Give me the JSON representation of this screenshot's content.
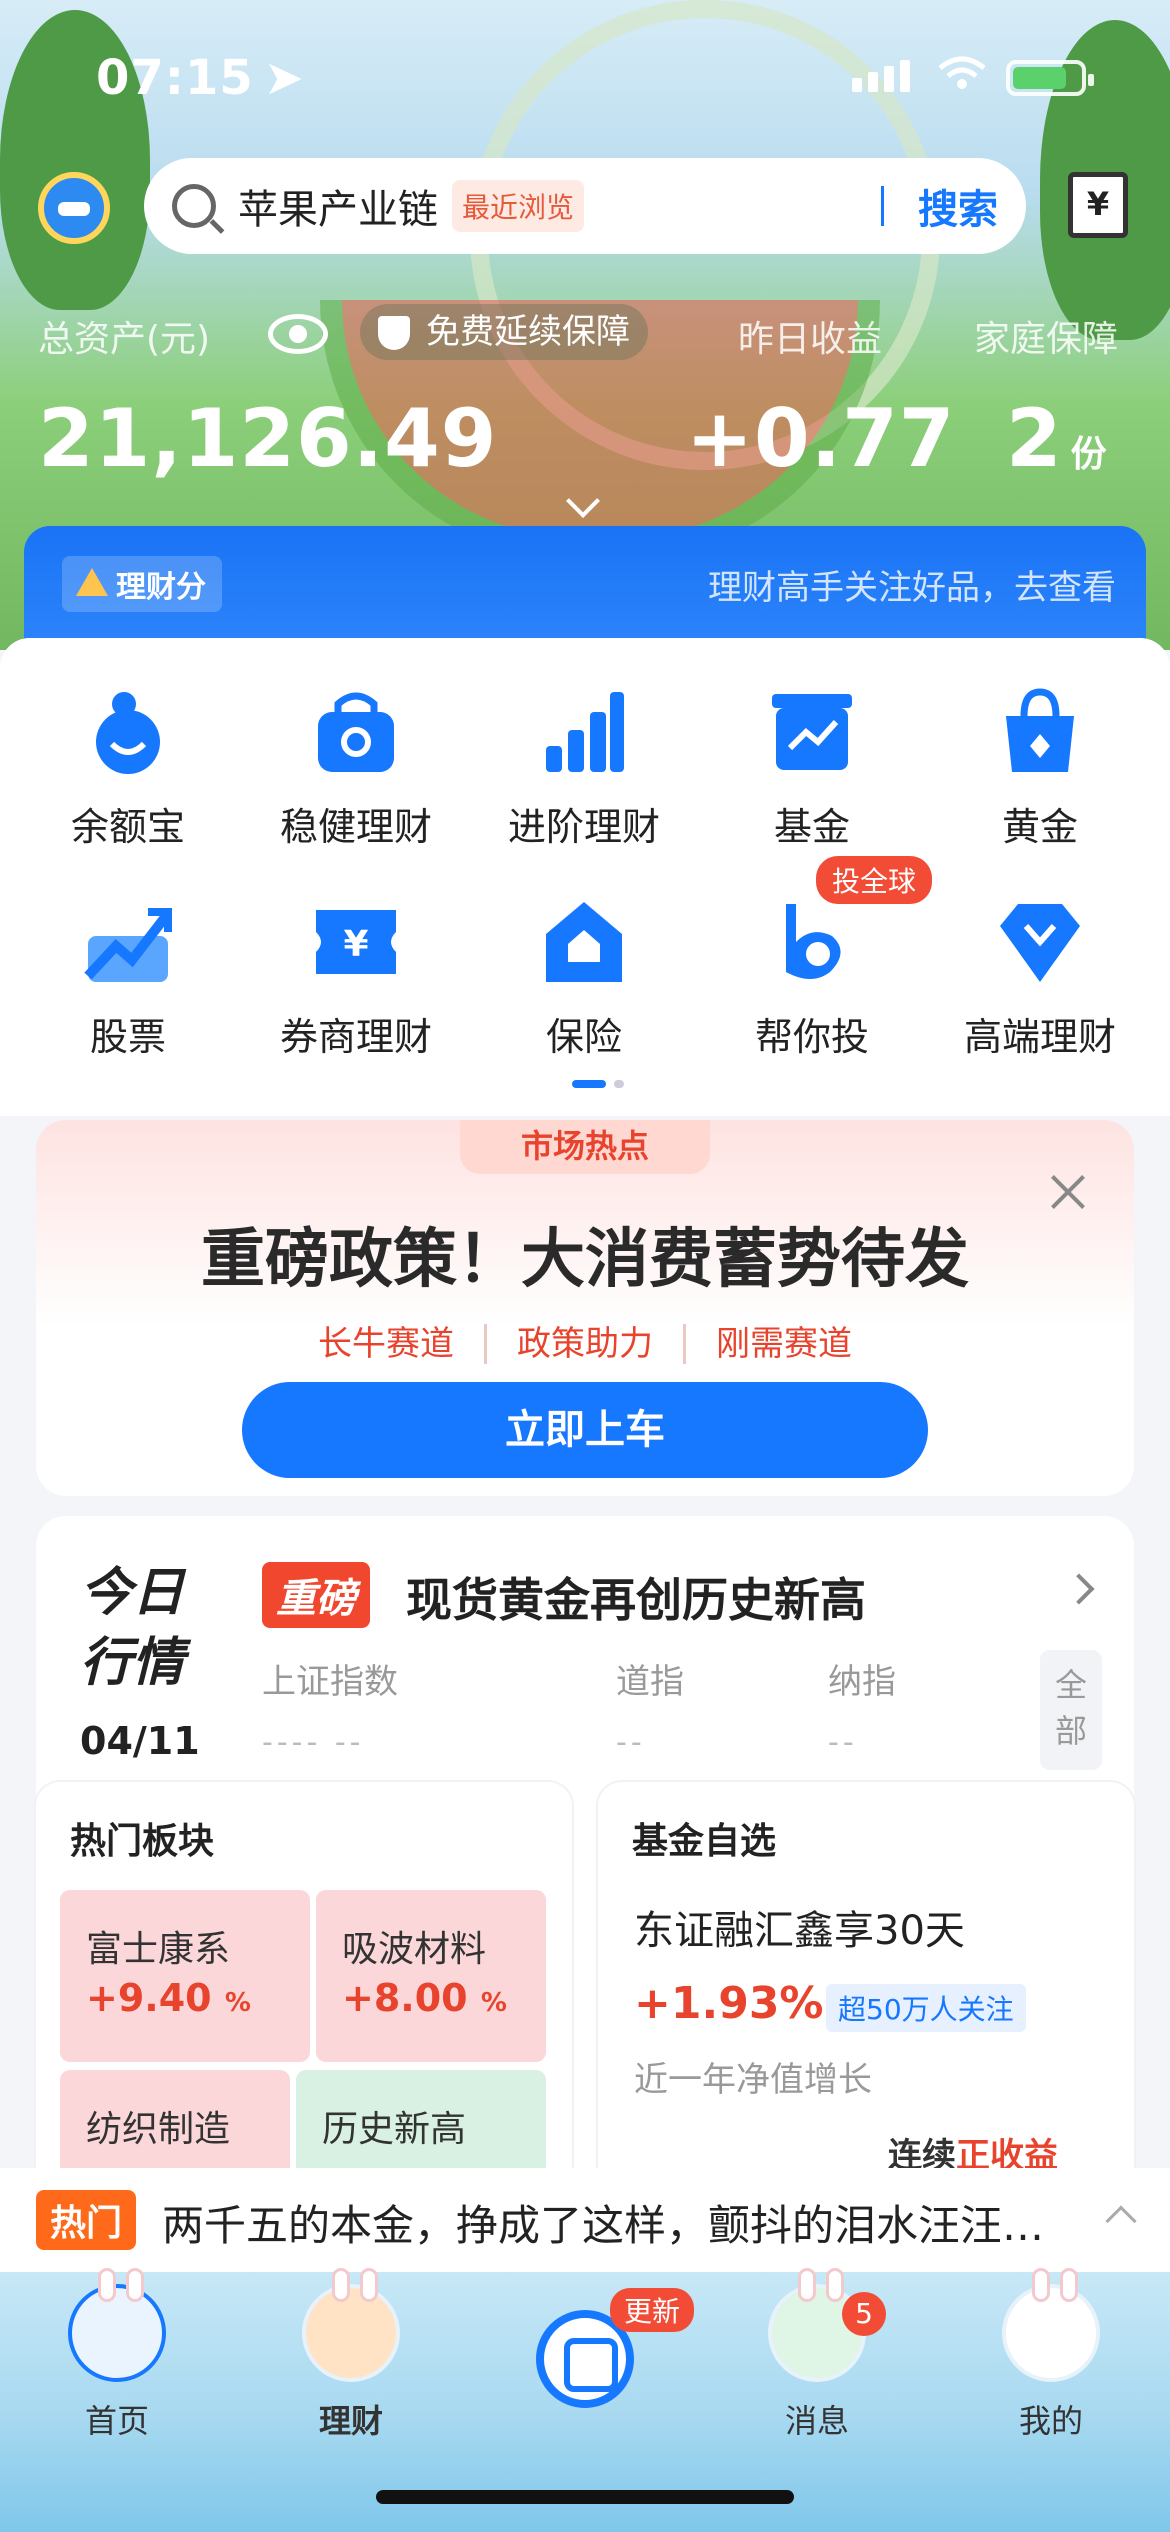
{
  "status": {
    "time": "07:15"
  },
  "search": {
    "keyword": "苹果产业链",
    "recent_chip": "最近浏览",
    "button": "搜索"
  },
  "assets": {
    "total_label": "总资产(元)",
    "total_value": "21,126.49",
    "protection_label": "免费延续保障",
    "yesterday_label": "昨日收益",
    "yesterday_value": "+0.77",
    "family_label": "家庭保障",
    "family_value": "2",
    "family_unit": "份"
  },
  "score": {
    "tag": "理财分",
    "text": "理财高手关注好品，去查看"
  },
  "grid": [
    {
      "label": "余额宝",
      "icon": "yuebao-icon"
    },
    {
      "label": "稳健理财",
      "icon": "stable-wallet-icon"
    },
    {
      "label": "进阶理财",
      "icon": "bar-chart-icon"
    },
    {
      "label": "基金",
      "icon": "fund-icon"
    },
    {
      "label": "黄金",
      "icon": "gold-bag-icon"
    },
    {
      "label": "股票",
      "icon": "stock-trend-icon"
    },
    {
      "label": "券商理财",
      "icon": "yen-ticket-icon"
    },
    {
      "label": "保险",
      "icon": "insurance-house-icon"
    },
    {
      "label": "帮你投",
      "icon": "help-invest-icon",
      "badge": "投全球"
    },
    {
      "label": "高端理财",
      "icon": "diamond-icon"
    }
  ],
  "promo": {
    "tab": "市场热点",
    "title": "重磅政策！大消费蓄势待发",
    "tags": [
      "长牛赛道",
      "政策助力",
      "刚需赛道"
    ],
    "button": "立即上车"
  },
  "market": {
    "title_line1": "今日",
    "title_line2": "行情",
    "date": "04/11",
    "chip": "重磅",
    "headline": "现货黄金再创历史新高",
    "indices": [
      {
        "name": "上证指数",
        "value": "----  --"
      },
      {
        "name": "道指",
        "value": "--"
      },
      {
        "name": "纳指",
        "value": "--"
      }
    ],
    "all_button": "全部"
  },
  "hot_sectors": {
    "title": "热门板块",
    "items": [
      {
        "name": "富士康系",
        "pct": "+9.40",
        "unit": "%"
      },
      {
        "name": "吸波材料",
        "pct": "+8.00",
        "unit": "%"
      },
      {
        "name": "纺织制造"
      },
      {
        "name": "历史新高"
      }
    ]
  },
  "fund_pick": {
    "title": "基金自选",
    "name": "东证融汇鑫享30天",
    "pct": "+1.93%",
    "tag": "超50万人关注",
    "sub": "近一年净值增长",
    "more_prefix": "连续",
    "more_highlight": "正收益"
  },
  "ticker": {
    "tag": "热门",
    "text": "两千五的本金，挣成了这样，颤抖的泪水汪汪…"
  },
  "tabbar": {
    "items": [
      "首页",
      "理财",
      "消息",
      "我的"
    ],
    "center_badge": "更新",
    "message_count": "5"
  },
  "colors": {
    "accent": "#1677ff",
    "rise": "#e8432d",
    "badge": "#f24b36"
  }
}
